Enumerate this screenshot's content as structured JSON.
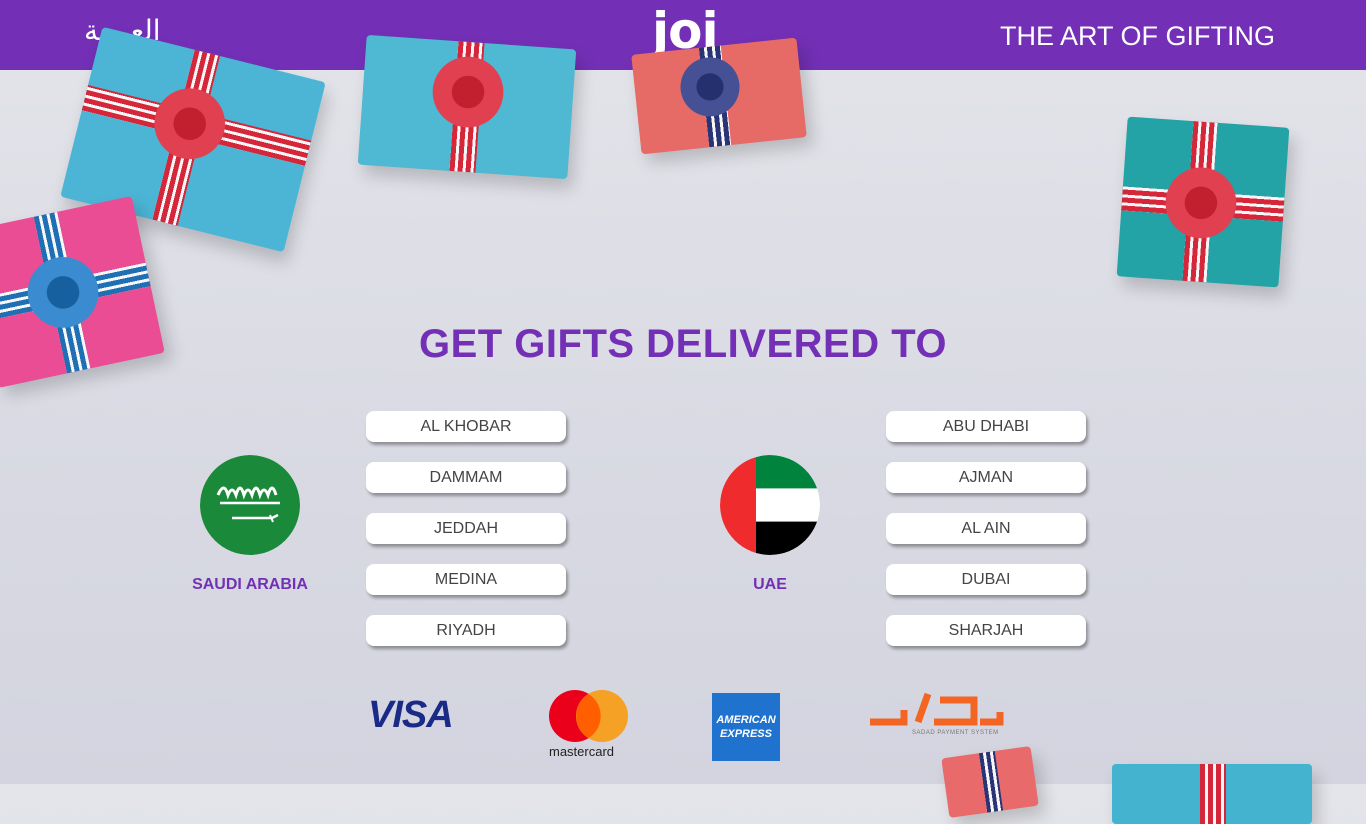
{
  "header": {
    "language_link": "العربية",
    "logo": "joi",
    "tagline": "THE ART OF GIFTING"
  },
  "main": {
    "title": "GET GIFTS DELIVERED TO",
    "countries": [
      {
        "name": "SAUDI ARABIA",
        "cities": [
          "AL KHOBAR",
          "DAMMAM",
          "JEDDAH",
          "MEDINA",
          "RIYADH"
        ]
      },
      {
        "name": "UAE",
        "cities": [
          "ABU DHABI",
          "AJMAN",
          "AL AIN",
          "DUBAI",
          "SHARJAH"
        ]
      }
    ]
  },
  "payments": {
    "visa": "VISA",
    "mastercard": "mastercard",
    "amex_line1": "AMERICAN",
    "amex_line2": "EXPRESS",
    "sadad_sub": "SADAD PAYMENT SYSTEM"
  },
  "colors": {
    "brand_purple": "#7330b6",
    "background": "#e4e5ea"
  }
}
